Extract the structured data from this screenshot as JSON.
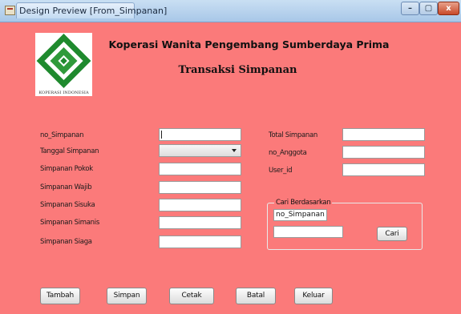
{
  "window": {
    "title": "Design Preview [From_Simpanan]",
    "controls": {
      "minimize": "–",
      "maximize": "▢",
      "close": "x"
    }
  },
  "header": {
    "logo_caption": "KOPERASI INDONESIA",
    "org_title": "Koperasi Wanita Pengembang Sumberdaya Prima",
    "page_title": "Transaksi Simpanan"
  },
  "form_left": [
    {
      "label": "no_Simpanan",
      "type": "text",
      "value": ""
    },
    {
      "label": "Tanggal Simpanan",
      "type": "combo",
      "value": ""
    },
    {
      "label": "Simpanan Pokok",
      "type": "text",
      "value": ""
    },
    {
      "label": "Simpanan Wajib",
      "type": "text",
      "value": ""
    },
    {
      "label": "Simpanan Sisuka",
      "type": "text",
      "value": ""
    },
    {
      "label": "Simpanan Simanis",
      "type": "text",
      "value": ""
    },
    {
      "label": "Simpanan Siaga",
      "type": "text",
      "value": ""
    }
  ],
  "form_right": [
    {
      "label": "Total Simpanan",
      "value": ""
    },
    {
      "label": "no_Anggota",
      "value": ""
    },
    {
      "label": "User_id",
      "value": ""
    }
  ],
  "search": {
    "group_title": "Cari Berdasarkan",
    "criteria_value": "no_Simpanan",
    "keyword_value": "",
    "button_label": "Cari"
  },
  "actions": [
    "Tambah",
    "Simpan",
    "Cetak",
    "Batal",
    "Keluar"
  ],
  "colors": {
    "background": "#fb7a7a",
    "logo_green": "#1f8a2e",
    "titlebar": "#b8d3ee"
  }
}
